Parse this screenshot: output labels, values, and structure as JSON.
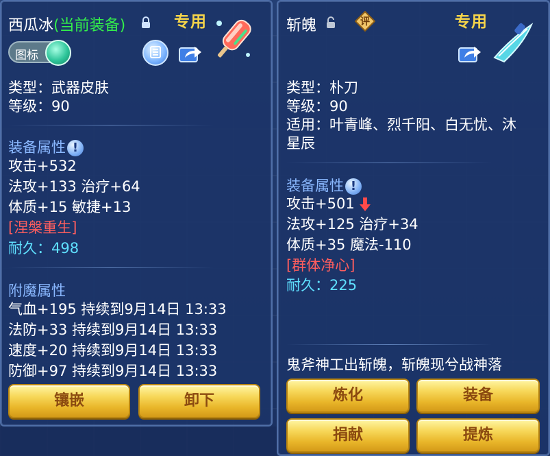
{
  "left_panel": {
    "title_name": "西瓜冰",
    "title_status": "(当前装备)",
    "special_label": "专用",
    "toggle_label": "图标",
    "lines": {
      "type": "类型：武器皮肤",
      "level": "等级：90"
    },
    "equip_attr_header": "装备属性",
    "attrs": [
      "攻击+532",
      "法攻+133 治疗+64",
      "体质+15 敏捷+13"
    ],
    "special_skill": "[涅槃重生]",
    "durability_label": "耐久：",
    "durability_value": "498",
    "enchant_header": "附魔属性",
    "enchants": [
      "气血+195 持续到9月14日 13:33",
      "法防+33 持续到9月14日 13:33",
      "速度+20 持续到9月14日 13:33",
      "防御+97 持续到9月14日 13:33"
    ],
    "buttons": {
      "inlay": "镶嵌",
      "unequip": "卸下"
    }
  },
  "right_panel": {
    "title_name": "斩魄",
    "rate_badge": "评",
    "special_label": "专用",
    "lines": {
      "type": "类型：朴刀",
      "level": "等级：90",
      "suitable_1": "适用：叶青峰、烈千阳、白无忧、沐",
      "suitable_2": "星辰"
    },
    "equip_attr_header": "装备属性",
    "attrs": [
      "攻击+501",
      "法攻+125 治疗+34",
      "体质+35 魔法-110"
    ],
    "special_skill": "[群体净心]",
    "durability_label": "耐久：",
    "durability_value": "225",
    "description": "鬼斧神工出斩魄，斩魄现兮战神落",
    "buttons": {
      "refine": "炼化",
      "equip": "装备",
      "donate": "捐献",
      "extract": "提炼"
    }
  },
  "colors": {
    "status_green": "#33f04a",
    "special_gold": "#f6d54a",
    "section_blue": "#8ab8ff",
    "durability_cyan": "#5fe0ff",
    "skill_red": "#ff5e5e",
    "button_gold": "#f7d85a"
  }
}
